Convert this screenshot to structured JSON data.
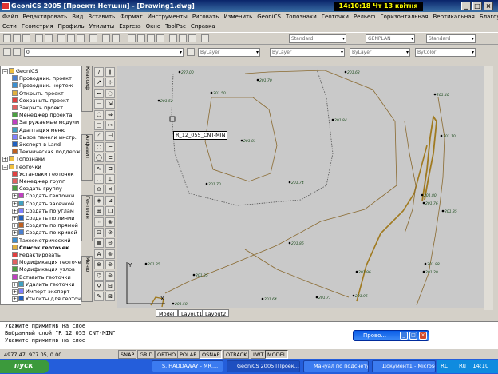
{
  "window": {
    "title": "GeoniCS 2005 [Проект: Нетшнн] - [Drawing1.dwg]",
    "clock": "14:10:18  Чт 13 квітня 2006"
  },
  "menu_main": [
    "Файл",
    "Редактировать",
    "Вид",
    "Вставить",
    "Формат",
    "Инструменты",
    "Рисовать",
    "Изменить",
    "GeoniCS",
    "Топознаки",
    "Геоточки",
    "Рельеф",
    "Горизонтальная",
    "Вертикальная",
    "Благоустройство"
  ],
  "menu_second": [
    "Сети",
    "Геометрия",
    "Профиль",
    "Утилиты",
    "Express",
    "Окно",
    "ToolPac",
    "Справка"
  ],
  "toolbar": {
    "text_style": "Standard",
    "dim_style": "GENPLAN",
    "table_style": "Standard",
    "layer_value": "0",
    "color": "ByLayer",
    "linetype": "ByLayer",
    "lineweight": "ByLayer",
    "plotstyle": "ByColor"
  },
  "tree": {
    "root": "GeoniCS",
    "items": [
      "Проводник. проект",
      "Проводник. чертеж",
      "Открыть проект",
      "Сохранить проект",
      "Закрыть проект",
      "Менеджер проекта",
      "Загружаемые модули",
      "Адаптация меню",
      "Вызов панели инстр.",
      "Экспорт в Land",
      "Техническая поддержка"
    ],
    "section_topo": "Топознаки",
    "section_geo": "Геоточки",
    "geo_items": [
      "Установки геоточек",
      "Менеджер групп",
      "Создать группу",
      "Создать геоточки",
      "Создать засечкой",
      "Создать по углам",
      "Создать по линии",
      "Создать по прямой",
      "Создать по кривой",
      "Тахеометрический",
      "Список геоточек",
      "Редактировать",
      "Модификация геоточек",
      "Модификация узлов",
      "Вставить геоточки",
      "Удалить геоточки",
      "Импорт-экспорт",
      "Утилиты для геоточек"
    ]
  },
  "side_tabs": [
    "Классиф",
    "Алфавит",
    "Генплан",
    "Меню"
  ],
  "canvas": {
    "tooltip": "R_12_055_CNT-MIN",
    "labels": [
      "227.00",
      "201.52",
      "201.70",
      "201.50",
      "201.81",
      "201.84",
      "201.63",
      "201.35",
      "201.40",
      "201.10",
      "201.50",
      "201.71",
      "201.70",
      "201.74",
      "201.86",
      "201.35",
      "201.80",
      "201.76",
      "201.96",
      "201.20",
      "201.58",
      "201.64",
      "201.85",
      "201.96",
      "201.88"
    ]
  },
  "layout_tabs": [
    "Model",
    "Layout1",
    "Layout2"
  ],
  "command_lines": [
    "Укажите примитив на слое",
    "Выбранный слой  \"R_12_055_CNT-MIN\"",
    "Укажите примитив на слое"
  ],
  "float_window": "Прово...",
  "status": {
    "coords": "4977.47, 977.05, 0.00",
    "toggles": [
      "SNAP",
      "GRID",
      "ORTHO",
      "POLAR",
      "OSNAP",
      "OTRACK",
      "LWT",
      "MODEL"
    ]
  },
  "taskbar": {
    "start": "пуск",
    "tasks": [
      "S. HADDAWAY - MR....",
      "GeoniCS 2005 [Проек...",
      "Мануал по подсчёту...",
      "Документ1 - Microsof..."
    ],
    "lang": "RL",
    "lang2": "Ru",
    "time": "14:10"
  }
}
